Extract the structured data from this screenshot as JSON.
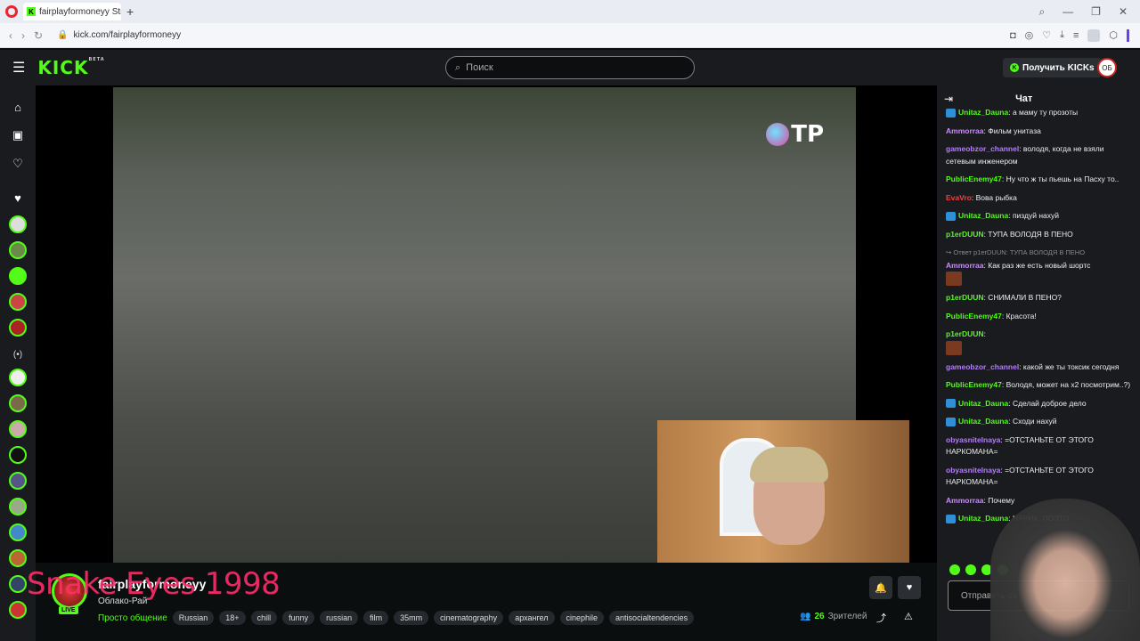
{
  "browser": {
    "tab_title": "fairplayformoneyy Str",
    "url": "kick.com/fairplayformoneyy"
  },
  "header": {
    "logo": "KICK",
    "logo_sup": "BETA",
    "search_placeholder": "Поиск",
    "get_kicks_label": "Получить KICKs",
    "user_initials": "ОБ"
  },
  "stream": {
    "watermark": "TP",
    "channel_name": "fairplayformoneyy",
    "title": "Облако-Рай",
    "overlay_text": "Snake Eyes 1998",
    "live_badge": "LIVE",
    "category": "Просто общение",
    "tags": [
      "Russian",
      "18+",
      "chill",
      "funny",
      "russian",
      "film",
      "35mm",
      "cinematography",
      "архангел",
      "cinephile",
      "antisocialtendencies"
    ],
    "viewers_count": "26",
    "viewers_label": "Зрителей"
  },
  "chat": {
    "title": "Чат",
    "input_placeholder": "Отправить со",
    "messages": [
      {
        "user": "Unitaz_Dauna",
        "color": "#53fc18",
        "badge": true,
        "text": "а маму ту прозоты"
      },
      {
        "user": "Ammorraa",
        "color": "#c98bff",
        "text": "Фильм унитаза"
      },
      {
        "user": "gameobzor_channel",
        "color": "#b57cff",
        "text": "володя, когда не взяли сетевым инженером"
      },
      {
        "user": "PublicEnemy47",
        "color": "#53fc18",
        "text": "Ну что ж ты пьешь на Пасху то.."
      },
      {
        "user": "EvaVro",
        "color": "#ff3b3b",
        "text": "Вова рыбка"
      },
      {
        "user": "Unitaz_Dauna",
        "color": "#53fc18",
        "badge": true,
        "text": "пиздуй нахуй"
      },
      {
        "user": "p1erDUUN",
        "color": "#53fc18",
        "text": "ТУПА ВОЛОДЯ В ПЕНО"
      },
      {
        "reply": "Ответ p1erDUUN: ТУПА ВОЛОДЯ В ПЕНО",
        "user": "Ammorraa",
        "color": "#c98bff",
        "text": "Как раз же есть новый шортс",
        "emote": true
      },
      {
        "user": "p1erDUUN",
        "color": "#53fc18",
        "text": "СНИМАЛИ В ПЕНО?"
      },
      {
        "user": "PublicEnemy47",
        "color": "#53fc18",
        "text": "Красота!"
      },
      {
        "user": "p1erDUUN",
        "color": "#53fc18",
        "text": "",
        "emote": true
      },
      {
        "user": "gameobzor_channel",
        "color": "#b57cff",
        "text": "какой же ты токсик сегодня"
      },
      {
        "user": "PublicEnemy47",
        "color": "#53fc18",
        "text": "Володя, может на x2 посмотрим..?)"
      },
      {
        "user": "Unitaz_Dauna",
        "color": "#53fc18",
        "badge": true,
        "text": "Сделай доброе дело"
      },
      {
        "user": "Unitaz_Dauna",
        "color": "#53fc18",
        "badge": true,
        "text": "Сходи нахуй"
      },
      {
        "user": "obyasnitelnaya",
        "color": "#b57cff",
        "text": "=ОТСТАНЬТЕ ОТ ЭТОГО НАРКОМАНА="
      },
      {
        "user": "obyasnitelnaya",
        "color": "#b57cff",
        "text": "=ОТСТАНЬТЕ ОТ ЭТОГО НАРКОМАНА="
      },
      {
        "user": "Ammorraa",
        "color": "#c98bff",
        "text": "Почему"
      },
      {
        "user": "Unitaz_Dauna",
        "color": "#53fc18",
        "badge": true,
        "text": "НАРИК, ПОЭТО"
      }
    ]
  }
}
